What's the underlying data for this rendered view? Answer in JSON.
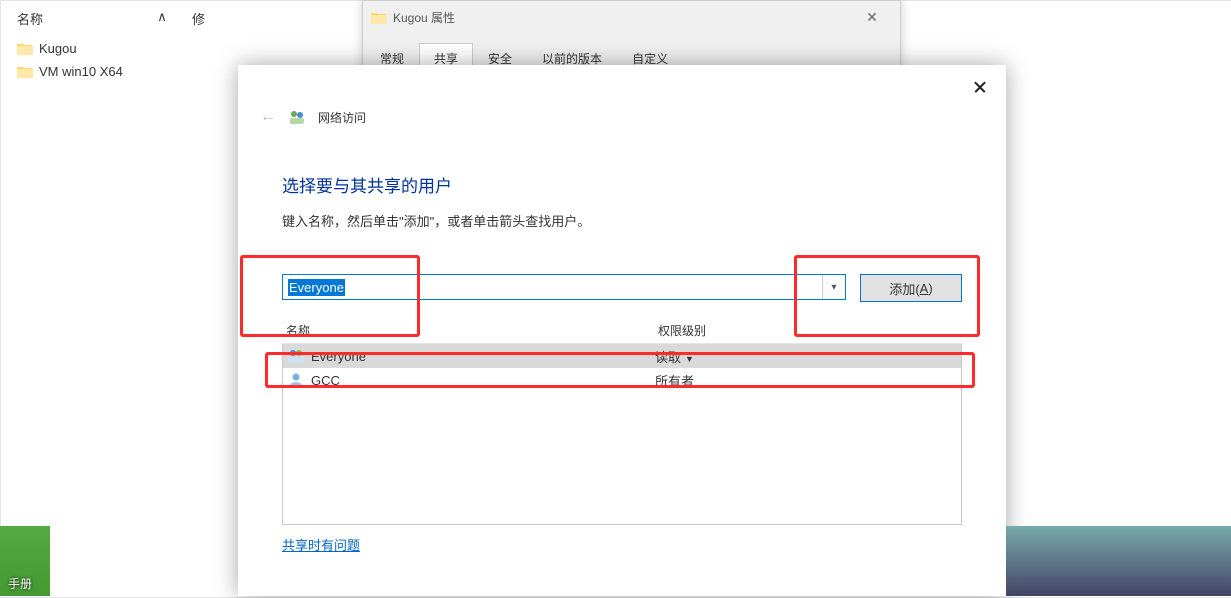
{
  "explorer": {
    "columns": {
      "name": "名称",
      "modified": "修"
    },
    "folders": [
      {
        "name": "Kugou"
      },
      {
        "name": "VM win10 X64"
      }
    ]
  },
  "propDialog": {
    "title": "Kugou 属性",
    "tabs": [
      "常规",
      "共享",
      "安全",
      "以前的版本",
      "自定义"
    ],
    "activeTabIndex": 1
  },
  "shareDialog": {
    "navLabel": "网络访问",
    "heading": "选择要与其共享的用户",
    "subtext": "键入名称，然后单击\"添加\"，或者单击箭头查找用户。",
    "inputValue": "Everyone",
    "addButton": {
      "label": "添加(",
      "accessKey": "A",
      "suffix": ")"
    },
    "columns": {
      "name": "名称",
      "perm": "权限级别"
    },
    "rows": [
      {
        "name": "Everyone",
        "level": "读取",
        "hasDropdown": true,
        "iconType": "group",
        "selected": true
      },
      {
        "name": "GCC",
        "level": "所有者",
        "hasDropdown": false,
        "iconType": "user",
        "selected": false
      }
    ],
    "helpLink": "共享时有问题"
  },
  "taskbar": {
    "label": "手册"
  }
}
